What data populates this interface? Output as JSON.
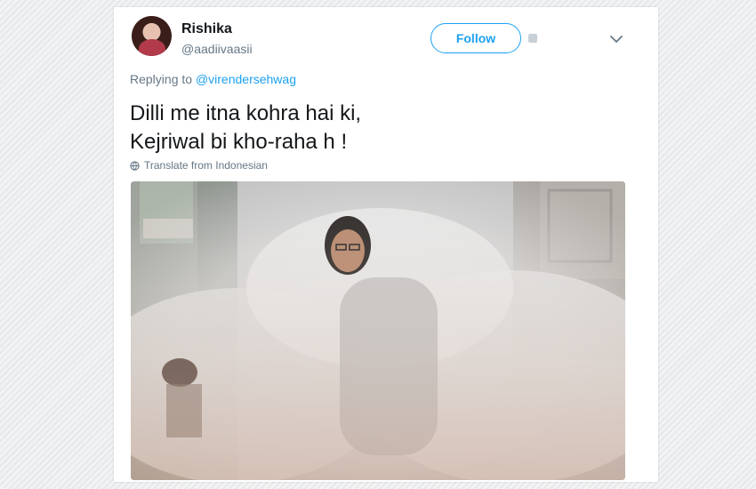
{
  "tweet": {
    "user": {
      "name": "Rishika",
      "handle": "@aadiivaasii"
    },
    "follow_label": "Follow",
    "replying_prefix": "Replying to",
    "replying_to": "@virendersehwag",
    "text_lines": [
      "Dilli me itna kohra hai ki,",
      "Kejriwal bi kho-raha h !"
    ],
    "translate_label": "Translate from Indonesian"
  },
  "colors": {
    "accent": "#1da1f2",
    "secondary_text": "#657786",
    "primary_text": "#14171a"
  },
  "icons": {
    "more": "chevron-down-icon",
    "translate": "globe-icon",
    "follow_extra": "user-icon"
  }
}
